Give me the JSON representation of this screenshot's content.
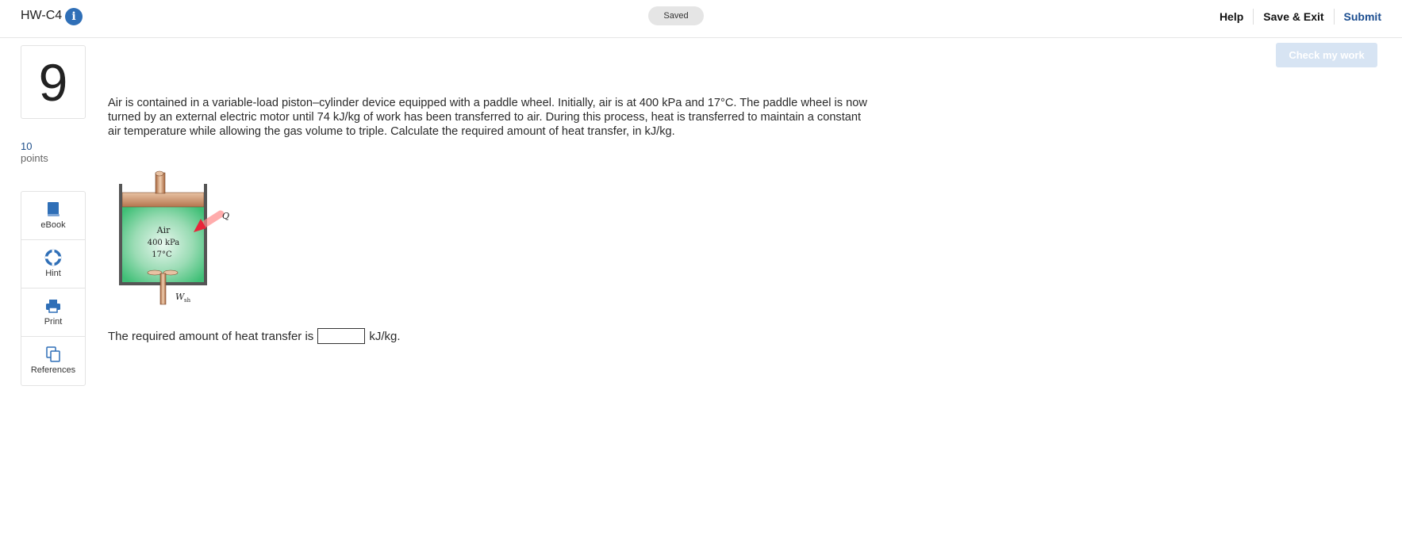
{
  "header": {
    "assignment_title": "HW-C4",
    "status": "Saved",
    "help_label": "Help",
    "save_exit_label": "Save & Exit",
    "submit_label": "Submit"
  },
  "check_label": "Check my work",
  "question": {
    "number": "9",
    "points_value": "10",
    "points_label": "points",
    "text": "Air is contained in a variable-load piston–cylinder device equipped with a paddle wheel. Initially, air is at 400 kPa and 17°C. The paddle wheel is now turned by an external electric motor until 74 kJ/kg of work has been transferred to air. During this process, heat is transferred to maintain a constant air temperature while allowing the gas volume to triple. Calculate the required amount of heat transfer, in kJ/kg.",
    "figure": {
      "gas_label": "Air",
      "pressure_label": "400 kPa",
      "temperature_label": "17°C",
      "heat_label": "Q",
      "work_label": "W",
      "work_subscript": "sh"
    },
    "answer_prefix": "The required amount of heat transfer is",
    "answer_value": "",
    "answer_suffix": "kJ/kg."
  },
  "tools": [
    {
      "label": "eBook",
      "icon": "book-icon"
    },
    {
      "label": "Hint",
      "icon": "lifebuoy-icon"
    },
    {
      "label": "Print",
      "icon": "printer-icon"
    },
    {
      "label": "References",
      "icon": "copy-documents-icon"
    }
  ],
  "colors": {
    "accent": "#2f6fb7",
    "submit": "#1b4d8f",
    "check_button_bg": "#d7e4f3",
    "gas_green": "#3fbf76",
    "piston_copper": "#c8906a"
  }
}
